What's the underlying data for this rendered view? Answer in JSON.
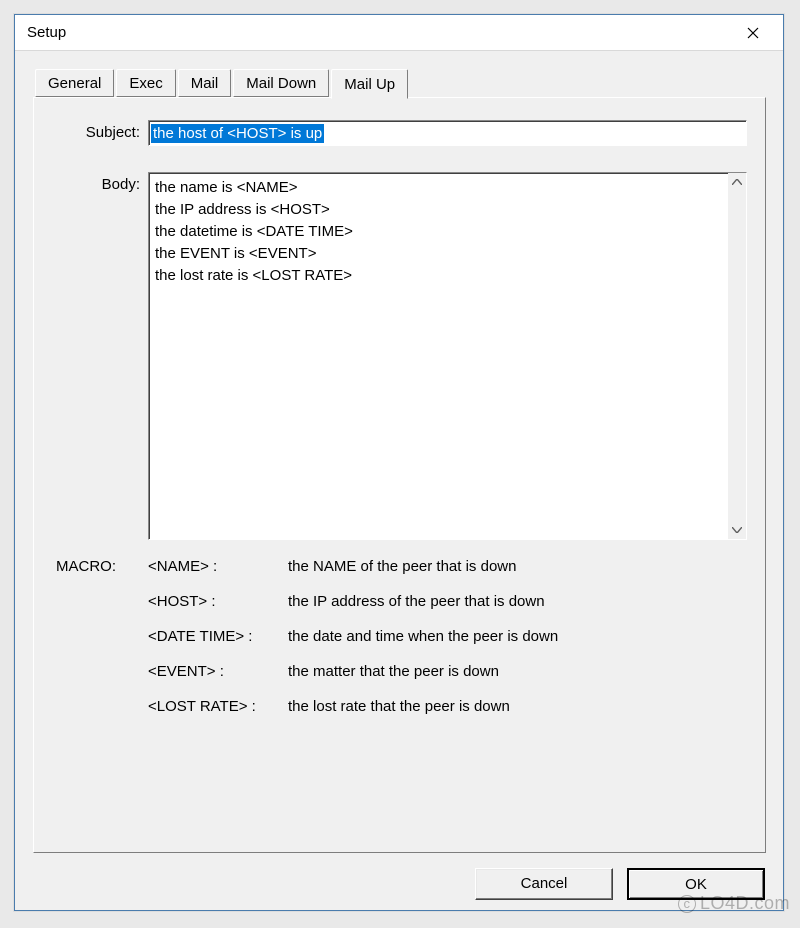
{
  "window": {
    "title": "Setup"
  },
  "tabs": [
    {
      "label": "General",
      "active": false
    },
    {
      "label": "Exec",
      "active": false
    },
    {
      "label": "Mail",
      "active": false
    },
    {
      "label": "Mail Down",
      "active": false
    },
    {
      "label": "Mail Up",
      "active": true
    }
  ],
  "form": {
    "subject_label": "Subject:",
    "subject_value": "the host of <HOST> is up",
    "body_label": "Body:",
    "body_value": "the name is <NAME>\nthe IP address is <HOST>\nthe datetime is <DATE TIME>\nthe EVENT is <EVENT>\nthe lost rate is <LOST RATE>"
  },
  "macro": {
    "heading": "MACRO:",
    "rows": [
      {
        "name": "<NAME> :",
        "desc": "the NAME of the peer that is down"
      },
      {
        "name": "<HOST> :",
        "desc": "the IP address of the peer that is down"
      },
      {
        "name": "<DATE TIME> :",
        "desc": "the date and time when the peer is down"
      },
      {
        "name": "<EVENT> :",
        "desc": "the matter that the peer is down"
      },
      {
        "name": "<LOST RATE> :",
        "desc": "the lost rate that the peer is down"
      }
    ]
  },
  "buttons": {
    "cancel": "Cancel",
    "ok": "OK"
  },
  "watermark": "LO4D.com"
}
